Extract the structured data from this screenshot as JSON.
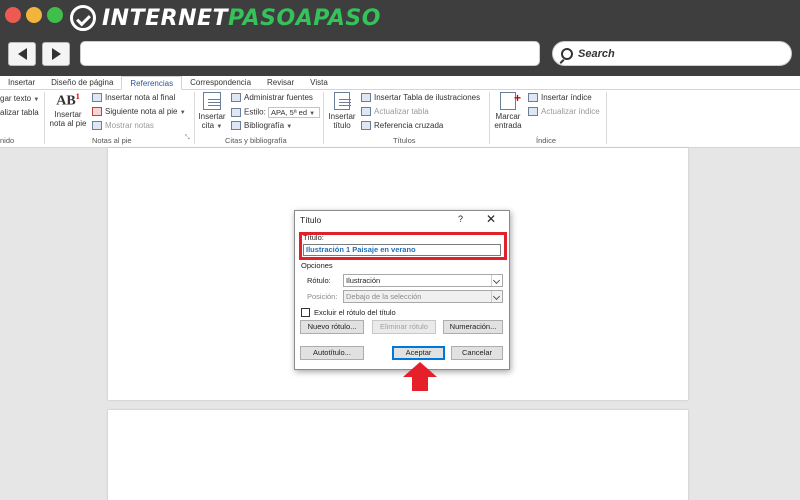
{
  "browser": {
    "logo_prefix": "INTERNET",
    "logo_accent": "PASOAPASO",
    "search_label": "Search"
  },
  "ribbon_tabs": [
    "Insertar",
    "Diseño de página",
    "Referencias",
    "Correspondencia",
    "Revisar",
    "Vista"
  ],
  "ribbon": {
    "toc": {
      "add_text": "gar texto",
      "update_table": "alizar tabla",
      "group": "nido"
    },
    "footnotes": {
      "insert_footnote": "Insertar",
      "insert_footnote_line2": "nota al pie",
      "insert_endnote": "Insertar nota al final",
      "next_footnote": "Siguiente nota al pie",
      "show_notes": "Mostrar notas",
      "group": "Notas al pie"
    },
    "citations": {
      "insert_citation": "Insertar",
      "insert_citation_line2": "cita",
      "manage_sources": "Administrar fuentes",
      "style_label": "Estilo:",
      "style_value": "APA, 5ª ed",
      "bibliography": "Bibliografía",
      "group": "Citas y bibliografía"
    },
    "captions": {
      "insert_caption": "Insertar",
      "insert_caption_line2": "título",
      "insert_table_figures": "Insertar Tabla de ilustraciones",
      "update_table": "Actualizar tabla",
      "cross_reference": "Referencia cruzada",
      "group": "Títulos"
    },
    "index": {
      "mark_entry": "Marcar",
      "mark_entry_line2": "entrada",
      "insert_index": "Insertar índice",
      "update_index": "Actualizar índice",
      "group": "Índice"
    }
  },
  "dialog": {
    "title": "Título",
    "help": "?",
    "close": "✕",
    "caption_label": "Título:",
    "caption_value": "Ilustración 1 Paisaje en verano",
    "options_label": "Opciones",
    "label_label": "Rótulo:",
    "label_value": "Ilustración",
    "position_label": "Posición:",
    "position_value": "Debajo de la selección",
    "exclude_label": "Excluir el rótulo del título",
    "new_label_button": "Nuevo rótulo...",
    "delete_label_button": "Eliminar rótulo",
    "numbering_button": "Numeración...",
    "autocaption_button": "Autotítulo...",
    "ok_button": "Aceptar",
    "cancel_button": "Cancelar"
  },
  "colors": {
    "highlight": "#e0202a",
    "accent_green": "#35c25a",
    "word_blue": "#2b579a"
  }
}
